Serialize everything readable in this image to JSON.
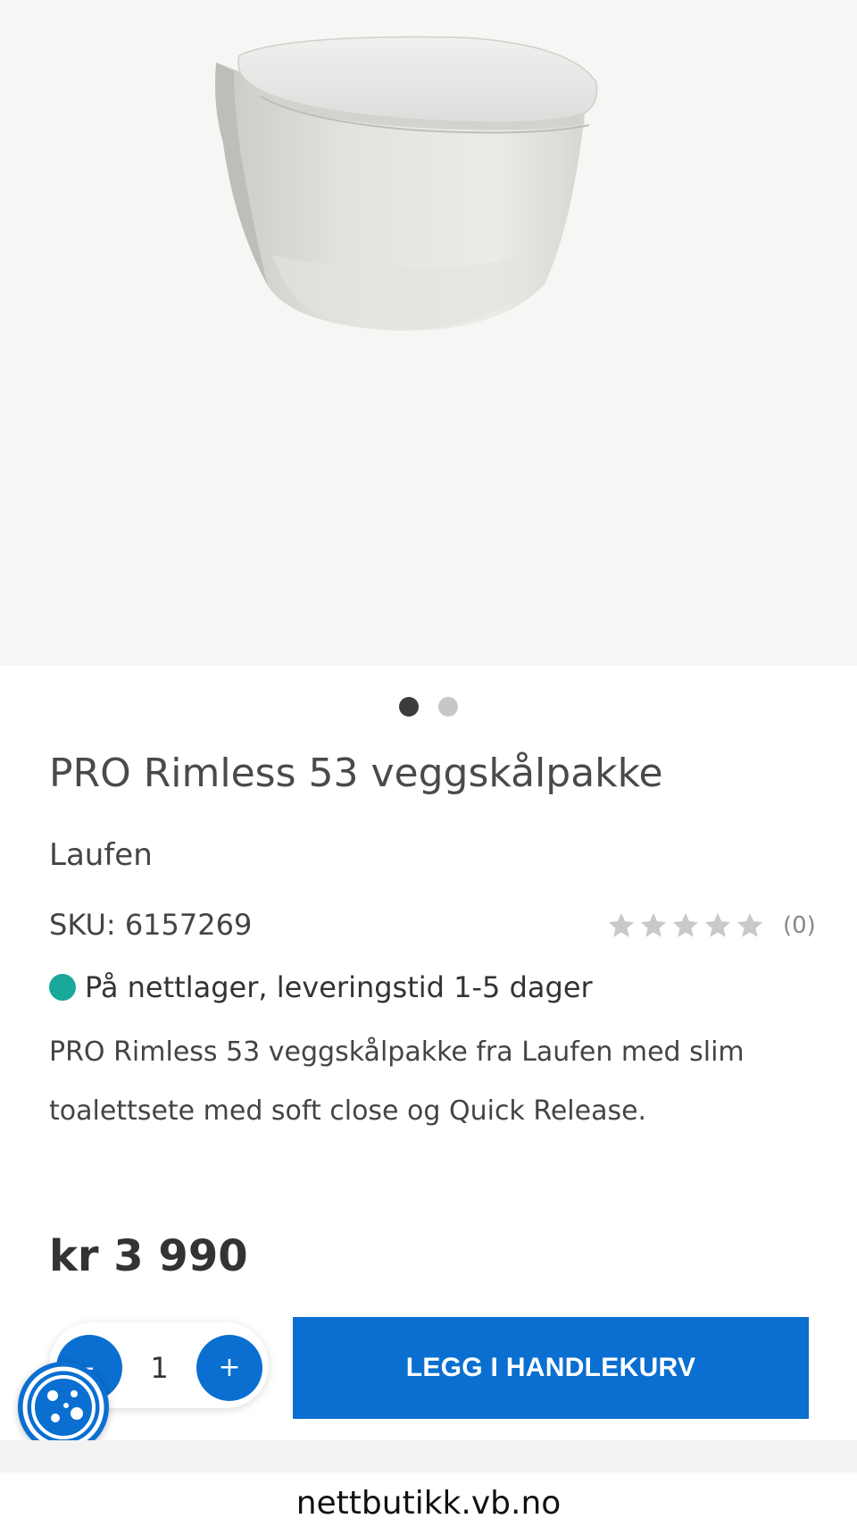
{
  "product": {
    "title": "PRO Rimless 53 veggskålpakke",
    "brand": "Laufen",
    "sku_label": "SKU: 6157269",
    "rating": {
      "stars": 0,
      "max_stars": 5,
      "count_label": "(0)"
    },
    "stock_text": "På nettlager, leveringstid 1-5 dager",
    "stock_color": "#18a99b",
    "description": "PRO Rimless 53 veggskålpakke fra Laufen med slim toalettsete med soft close og Quick Release.",
    "price": "kr 3 990"
  },
  "gallery": {
    "image_count": 2,
    "active_index": 0
  },
  "cart": {
    "minus_label": "-",
    "quantity": "1",
    "plus_label": "+",
    "add_to_cart_label": "LEGG I HANDLEKURV"
  },
  "colors": {
    "accent": "#0a6fd0",
    "star_empty": "#c9c9c9"
  },
  "icons": {
    "cookie": "cookie-icon",
    "star": "star-icon"
  },
  "browser": {
    "url": "nettbutikk.vb.no"
  }
}
